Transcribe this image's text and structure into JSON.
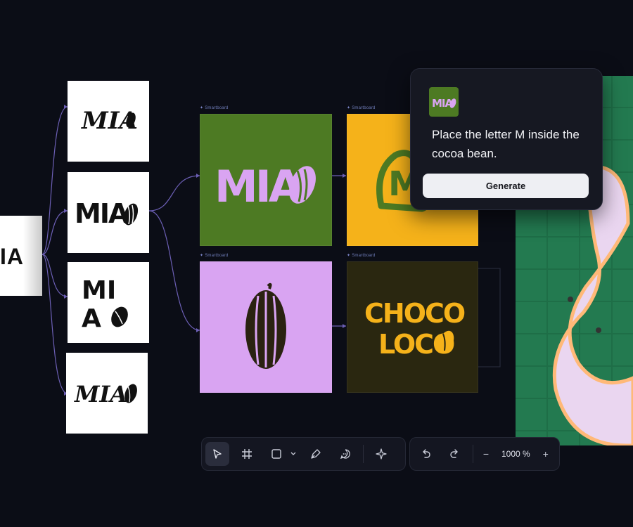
{
  "smartboard_labels": [
    "Smartboard",
    "Smartboard",
    "Smartboard",
    "Smartboard"
  ],
  "left_card_text": "IA",
  "logo_variants": [
    {
      "text": "MIA",
      "style": "script"
    },
    {
      "text": "MIA",
      "style": "bubbly"
    },
    {
      "text_top": "MI",
      "text_bottom": "A",
      "style": "stacked-bold"
    },
    {
      "text": "MIA",
      "style": "italic-bold"
    }
  ],
  "boards": [
    {
      "text": "MIA",
      "bg": "#4d7a23",
      "fg": "#d9a4f2"
    },
    {
      "text": "M",
      "bg": "#f5b21a",
      "fg": "#4d7a23"
    },
    {
      "icon": "cocoa-bean",
      "bg": "#d9a4f2",
      "fg": "#2a2211"
    },
    {
      "text_top": "CHOCO",
      "text_bottom": "LOCO",
      "bg": "#2a2710",
      "fg": "#f5b21a"
    }
  ],
  "popup": {
    "prompt": "Place the letter M inside the cocoa bean.",
    "generate_label": "Generate",
    "thumb_text": "MIA"
  },
  "toolbar": {
    "tools": [
      "select-tool",
      "frame-tool",
      "rectangle-tool",
      "pen-tool",
      "comment-tool",
      "ai-sparkle-tool"
    ],
    "zoom_label": "1000 %"
  },
  "colors": {
    "background": "#0b0d16",
    "connector": "#6c5fb5",
    "green": "#4d7a23",
    "yellow": "#f5b21a",
    "lilac": "#d9a4f2",
    "dark_brown": "#2a2710"
  }
}
